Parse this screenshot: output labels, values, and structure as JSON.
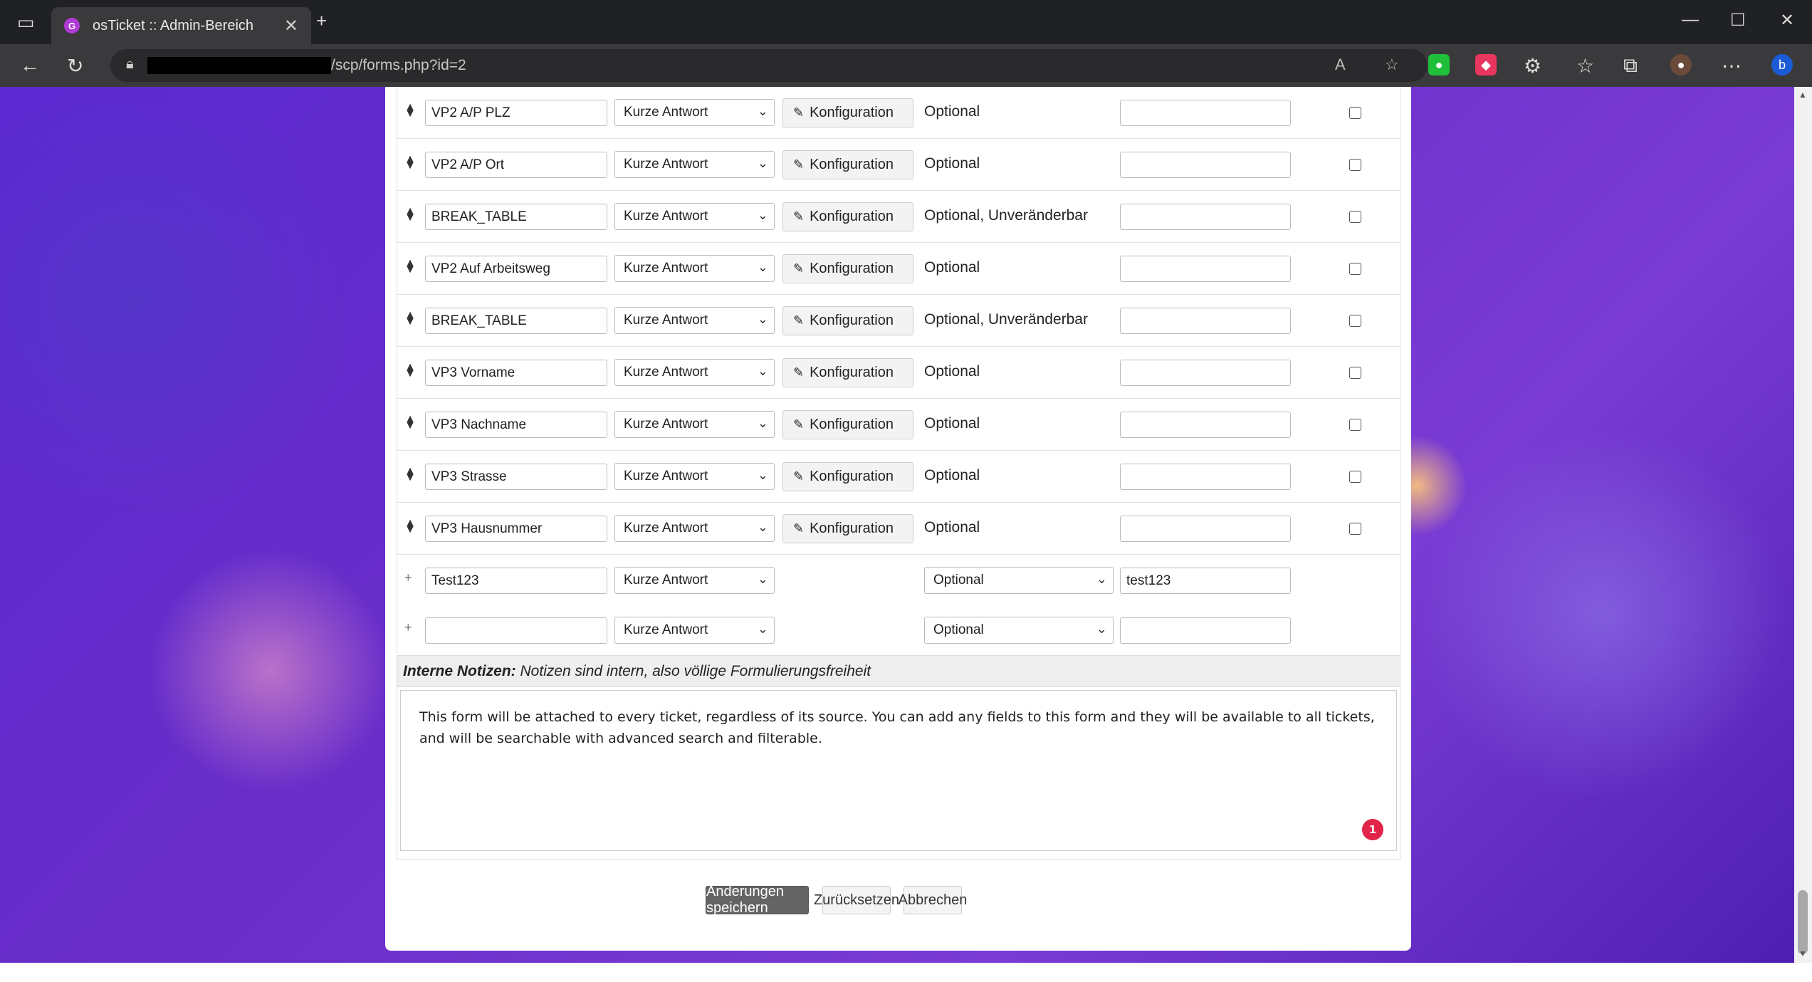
{
  "browser": {
    "tab_title": "osTicket :: Admin-Bereich",
    "favicon_letter": "G",
    "url": "/scp/forms.php?id=2"
  },
  "fields": [
    {
      "label": "VP2 A/P PLZ",
      "type": "Kurze Antwort",
      "config": "Konfiguration",
      "visibility": "Optional",
      "name": ""
    },
    {
      "label": "VP2 A/P Ort",
      "type": "Kurze Antwort",
      "config": "Konfiguration",
      "visibility": "Optional",
      "name": ""
    },
    {
      "label": "BREAK_TABLE",
      "type": "Kurze Antwort",
      "config": "Konfiguration",
      "visibility": "Optional, Unveränderbar",
      "name": ""
    },
    {
      "label": "VP2 Auf Arbeitsweg",
      "type": "Kurze Antwort",
      "config": "Konfiguration",
      "visibility": "Optional",
      "name": ""
    },
    {
      "label": "BREAK_TABLE",
      "type": "Kurze Antwort",
      "config": "Konfiguration",
      "visibility": "Optional, Unveränderbar",
      "name": ""
    },
    {
      "label": "VP3 Vorname",
      "type": "Kurze Antwort",
      "config": "Konfiguration",
      "visibility": "Optional",
      "name": ""
    },
    {
      "label": "VP3 Nachname",
      "type": "Kurze Antwort",
      "config": "Konfiguration",
      "visibility": "Optional",
      "name": ""
    },
    {
      "label": "VP3 Strasse",
      "type": "Kurze Antwort",
      "config": "Konfiguration",
      "visibility": "Optional",
      "name": ""
    },
    {
      "label": "VP3 Hausnummer",
      "type": "Kurze Antwort",
      "config": "Konfiguration",
      "visibility": "Optional",
      "name": ""
    }
  ],
  "new_fields": [
    {
      "label": "Test123",
      "type": "Kurze Antwort",
      "visibility": "Optional",
      "name": "test123"
    },
    {
      "label": "",
      "type": "Kurze Antwort",
      "visibility": "Optional",
      "name": ""
    }
  ],
  "notes": {
    "heading": "Interne Notizen:",
    "subheading": "Notizen sind intern, also völlige Formulierungsfreiheit",
    "text": "This form will be attached to every ticket, regardless of its source. You can add any fields to this form and they will be available to all tickets, and will be searchable with advanced search and filterable.",
    "badge": "1"
  },
  "actions": {
    "save": "Änderungen speichern",
    "reset": "Zurücksetzen",
    "cancel": "Abbrechen"
  }
}
